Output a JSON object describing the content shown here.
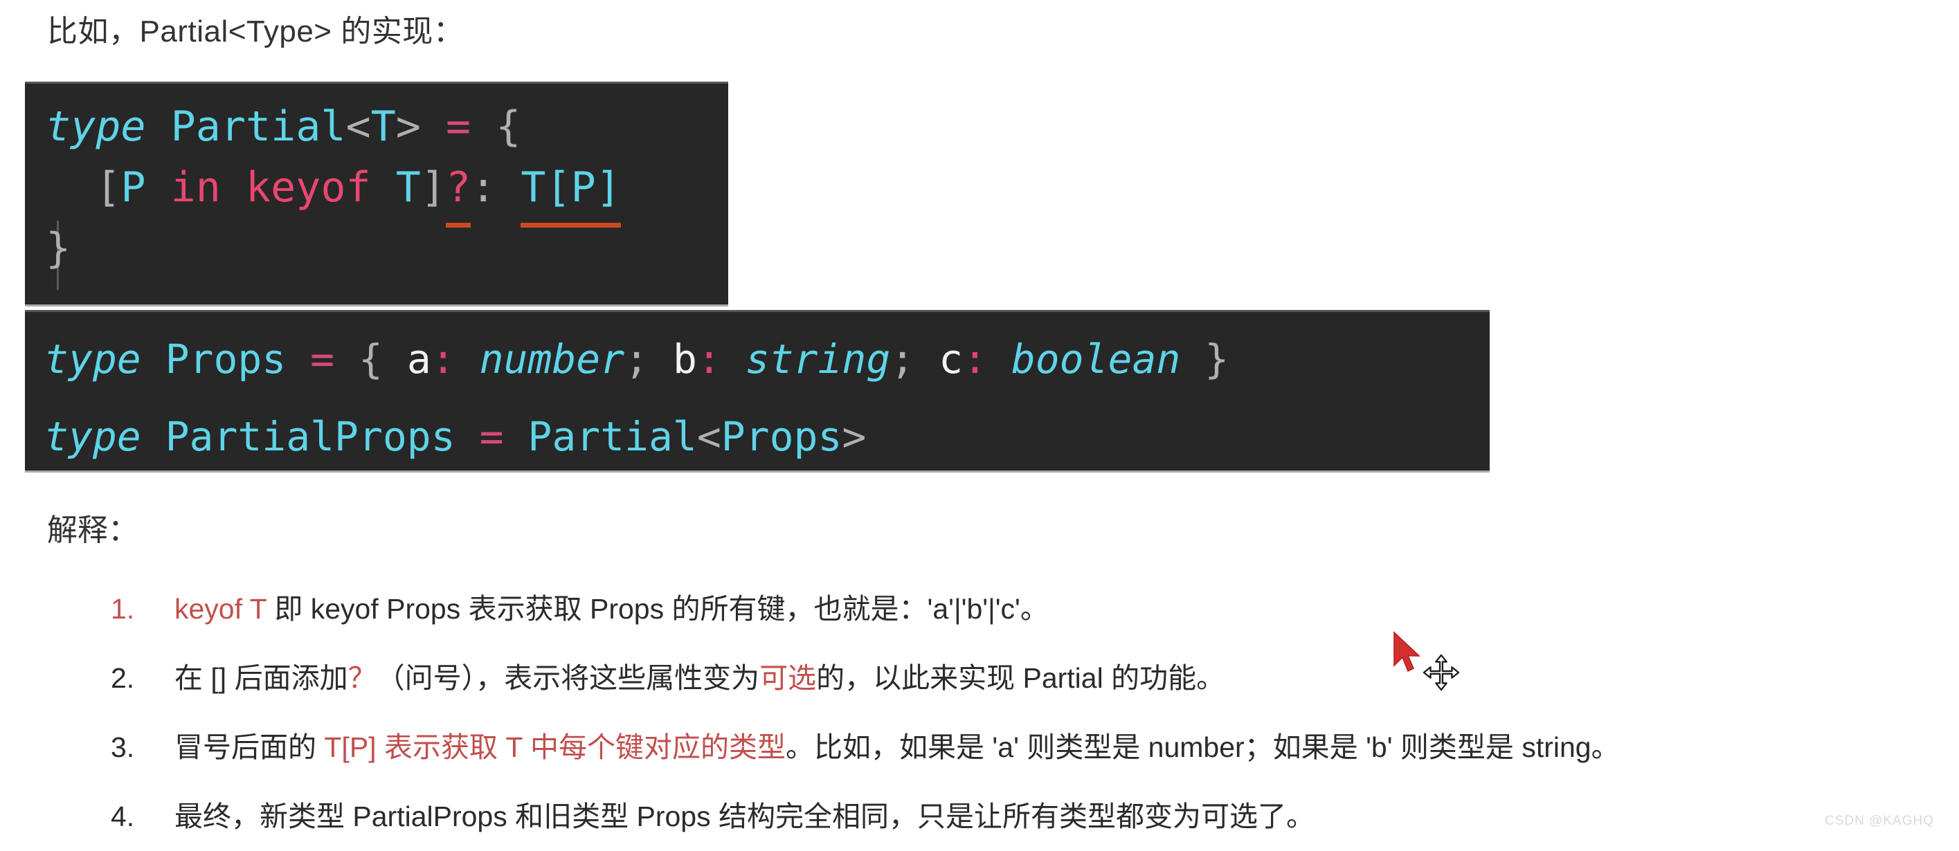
{
  "intro": {
    "text": "比如，Partial<Type> 的实现："
  },
  "code_block_1": {
    "language": "typescript",
    "lines": [
      {
        "tokens": [
          {
            "text": "type",
            "style": "keyword"
          },
          {
            "text": " ",
            "style": "plain"
          },
          {
            "text": "Partial",
            "style": "type"
          },
          {
            "text": "<",
            "style": "punct"
          },
          {
            "text": "T",
            "style": "type"
          },
          {
            "text": ">",
            "style": "punct"
          },
          {
            "text": " ",
            "style": "plain"
          },
          {
            "text": "=",
            "style": "operator"
          },
          {
            "text": " ",
            "style": "plain"
          },
          {
            "text": "{",
            "style": "punct"
          }
        ]
      },
      {
        "tokens": [
          {
            "text": "  ",
            "style": "plain"
          },
          {
            "text": "[",
            "style": "punct"
          },
          {
            "text": "P",
            "style": "type"
          },
          {
            "text": " ",
            "style": "plain"
          },
          {
            "text": "in",
            "style": "pink"
          },
          {
            "text": " ",
            "style": "plain"
          },
          {
            "text": "keyof",
            "style": "pink"
          },
          {
            "text": " ",
            "style": "plain"
          },
          {
            "text": "T",
            "style": "type"
          },
          {
            "text": "]",
            "style": "punct"
          },
          {
            "text": "?",
            "style": "pink-underline"
          },
          {
            "text": ":",
            "style": "punct"
          },
          {
            "text": " ",
            "style": "plain"
          },
          {
            "text": "T[P]",
            "style": "type-underline"
          }
        ]
      },
      {
        "tokens": [
          {
            "text": "}",
            "style": "punct"
          }
        ]
      }
    ]
  },
  "code_block_2": {
    "language": "typescript",
    "lines": [
      {
        "tokens": [
          {
            "text": "type",
            "style": "keyword"
          },
          {
            "text": " ",
            "style": "plain"
          },
          {
            "text": "Props",
            "style": "type"
          },
          {
            "text": " ",
            "style": "plain"
          },
          {
            "text": "=",
            "style": "operator"
          },
          {
            "text": " ",
            "style": "plain"
          },
          {
            "text": "{",
            "style": "punct"
          },
          {
            "text": " ",
            "style": "plain"
          },
          {
            "text": "a",
            "style": "ident"
          },
          {
            "text": ":",
            "style": "colon"
          },
          {
            "text": " ",
            "style": "plain"
          },
          {
            "text": "number",
            "style": "type-italic"
          },
          {
            "text": ";",
            "style": "punct"
          },
          {
            "text": " ",
            "style": "plain"
          },
          {
            "text": "b",
            "style": "ident"
          },
          {
            "text": ":",
            "style": "colon"
          },
          {
            "text": " ",
            "style": "plain"
          },
          {
            "text": "string",
            "style": "type-italic"
          },
          {
            "text": ";",
            "style": "punct"
          },
          {
            "text": " ",
            "style": "plain"
          },
          {
            "text": "c",
            "style": "ident"
          },
          {
            "text": ":",
            "style": "colon"
          },
          {
            "text": " ",
            "style": "plain"
          },
          {
            "text": "boolean",
            "style": "type-italic"
          },
          {
            "text": " ",
            "style": "plain"
          },
          {
            "text": "}",
            "style": "punct"
          }
        ]
      },
      {
        "tokens": [
          {
            "text": "type",
            "style": "keyword"
          },
          {
            "text": " ",
            "style": "plain"
          },
          {
            "text": "PartialProps",
            "style": "type"
          },
          {
            "text": " ",
            "style": "plain"
          },
          {
            "text": "=",
            "style": "operator"
          },
          {
            "text": " ",
            "style": "plain"
          },
          {
            "text": "Partial",
            "style": "type"
          },
          {
            "text": "<",
            "style": "punct"
          },
          {
            "text": "Props",
            "style": "type"
          },
          {
            "text": ">",
            "style": "punct"
          }
        ]
      }
    ]
  },
  "explain": {
    "title": "解释：",
    "items": [
      {
        "number": "1.",
        "number_red": true,
        "segments": [
          {
            "text": "keyof T",
            "red": true
          },
          {
            "text": " 即 keyof Props 表示获取 Props 的所有键，也就是：'a'|'b'|'c'。",
            "red": false
          }
        ]
      },
      {
        "number": "2.",
        "number_red": false,
        "segments": [
          {
            "text": "在 [] 后面添加",
            "red": false
          },
          {
            "text": "？",
            "red": true
          },
          {
            "text": "（问号），表示将这些属性变为",
            "red": false
          },
          {
            "text": "可选",
            "red": true
          },
          {
            "text": "的，以此来实现 Partial 的功能。",
            "red": false
          }
        ]
      },
      {
        "number": "3.",
        "number_red": false,
        "segments": [
          {
            "text": "冒号后面的 ",
            "red": false
          },
          {
            "text": "T[P] 表示获取 T 中每个键对应的类型",
            "red": true
          },
          {
            "text": "。比如，如果是 'a' 则类型是 number；如果是 'b' 则类型是 string。",
            "red": false
          }
        ]
      },
      {
        "number": "4.",
        "number_red": false,
        "segments": [
          {
            "text": "最终，新类型 PartialProps 和旧类型 Props 结构完全相同，只是让所有类型都变为可选了。",
            "red": false
          }
        ]
      }
    ]
  },
  "watermark": {
    "text": "CSDN @KAGHQ"
  },
  "colors": {
    "code_background": "#272727",
    "keyword_cyan": "#5ed4e8",
    "operator_pink": "#d84a7a",
    "punct_gray": "#b0b0b0",
    "error_underline": "#cc4a22",
    "accent_red": "#c0504d",
    "cursor_red": "#d32f2f",
    "page_background": "#ffffff"
  }
}
